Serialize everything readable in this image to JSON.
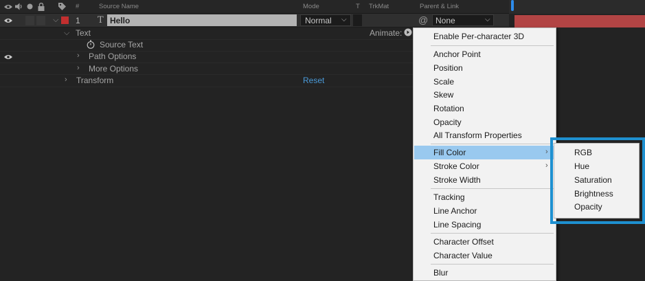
{
  "header": {
    "col_num": "#",
    "col_source_name": "Source Name",
    "col_mode": "Mode",
    "col_t": "T",
    "col_trkmat": "TrkMat",
    "col_parent": "Parent & Link"
  },
  "layer": {
    "number": "1",
    "type_glyph": "T",
    "name": "Hello",
    "mode": "Normal",
    "parent": "None",
    "label_color": "#c22f2f"
  },
  "properties": {
    "text": "Text",
    "animate_label": "Animate:",
    "source_text": "Source Text",
    "path_options": "Path Options",
    "more_options": "More Options",
    "transform": "Transform",
    "reset": "Reset"
  },
  "menu": {
    "enable_per_char_3d": "Enable Per-character 3D",
    "anchor_point": "Anchor Point",
    "position": "Position",
    "scale": "Scale",
    "skew": "Skew",
    "rotation": "Rotation",
    "opacity": "Opacity",
    "all_transform": "All Transform Properties",
    "fill_color": "Fill Color",
    "stroke_color": "Stroke Color",
    "stroke_width": "Stroke Width",
    "tracking": "Tracking",
    "line_anchor": "Line Anchor",
    "line_spacing": "Line Spacing",
    "character_offset": "Character Offset",
    "character_value": "Character Value",
    "blur": "Blur"
  },
  "submenu": {
    "rgb": "RGB",
    "hue": "Hue",
    "saturation": "Saturation",
    "brightness": "Brightness",
    "opacity": "Opacity"
  },
  "colors": {
    "highlight": "#99c9ef",
    "callout": "#1e90d0",
    "link": "#4a9ad8"
  }
}
